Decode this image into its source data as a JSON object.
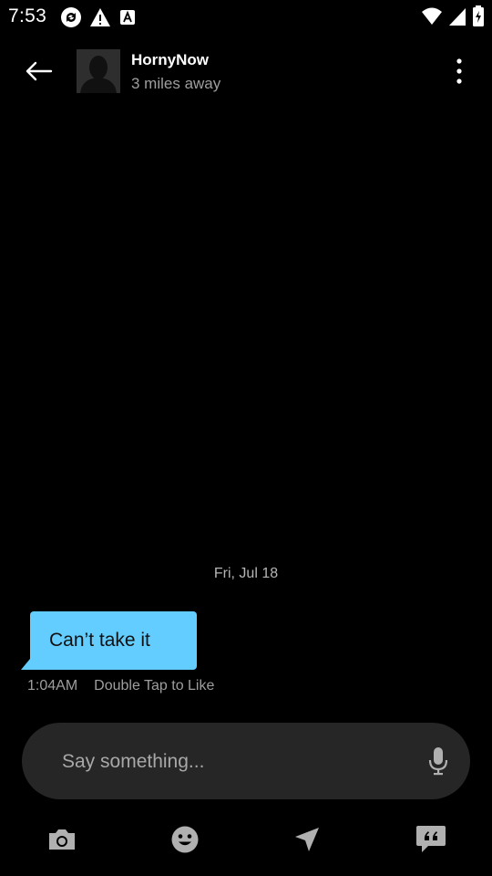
{
  "status_bar": {
    "time": "7:53",
    "left_icons": [
      "sync-icon",
      "warning-icon",
      "autofill-icon"
    ],
    "right_icons": [
      "wifi-icon",
      "cell-signal-icon",
      "battery-icon"
    ]
  },
  "header": {
    "profile_name": "HornyNow",
    "distance": "3 miles away",
    "back_icon": "back-arrow-icon",
    "more_icon": "more-vertical-icon"
  },
  "conversation": {
    "date_label": "Fri, Jul 18",
    "messages": [
      {
        "text": "Can’t take it",
        "time": "1:04AM",
        "hint": "Double Tap to Like"
      }
    ]
  },
  "compose": {
    "placeholder": "Say something...",
    "mic_icon": "microphone-icon"
  },
  "toolbar": {
    "items": [
      {
        "icon": "camera-icon"
      },
      {
        "icon": "emoji-icon"
      },
      {
        "icon": "send-location-icon"
      },
      {
        "icon": "quick-phrases-icon"
      }
    ]
  },
  "colors": {
    "background": "#000000",
    "bubble": "#63cdff",
    "compose_background": "#262626",
    "secondary_text": "#9e9e9e",
    "icon_gray": "#b0b0b0"
  }
}
